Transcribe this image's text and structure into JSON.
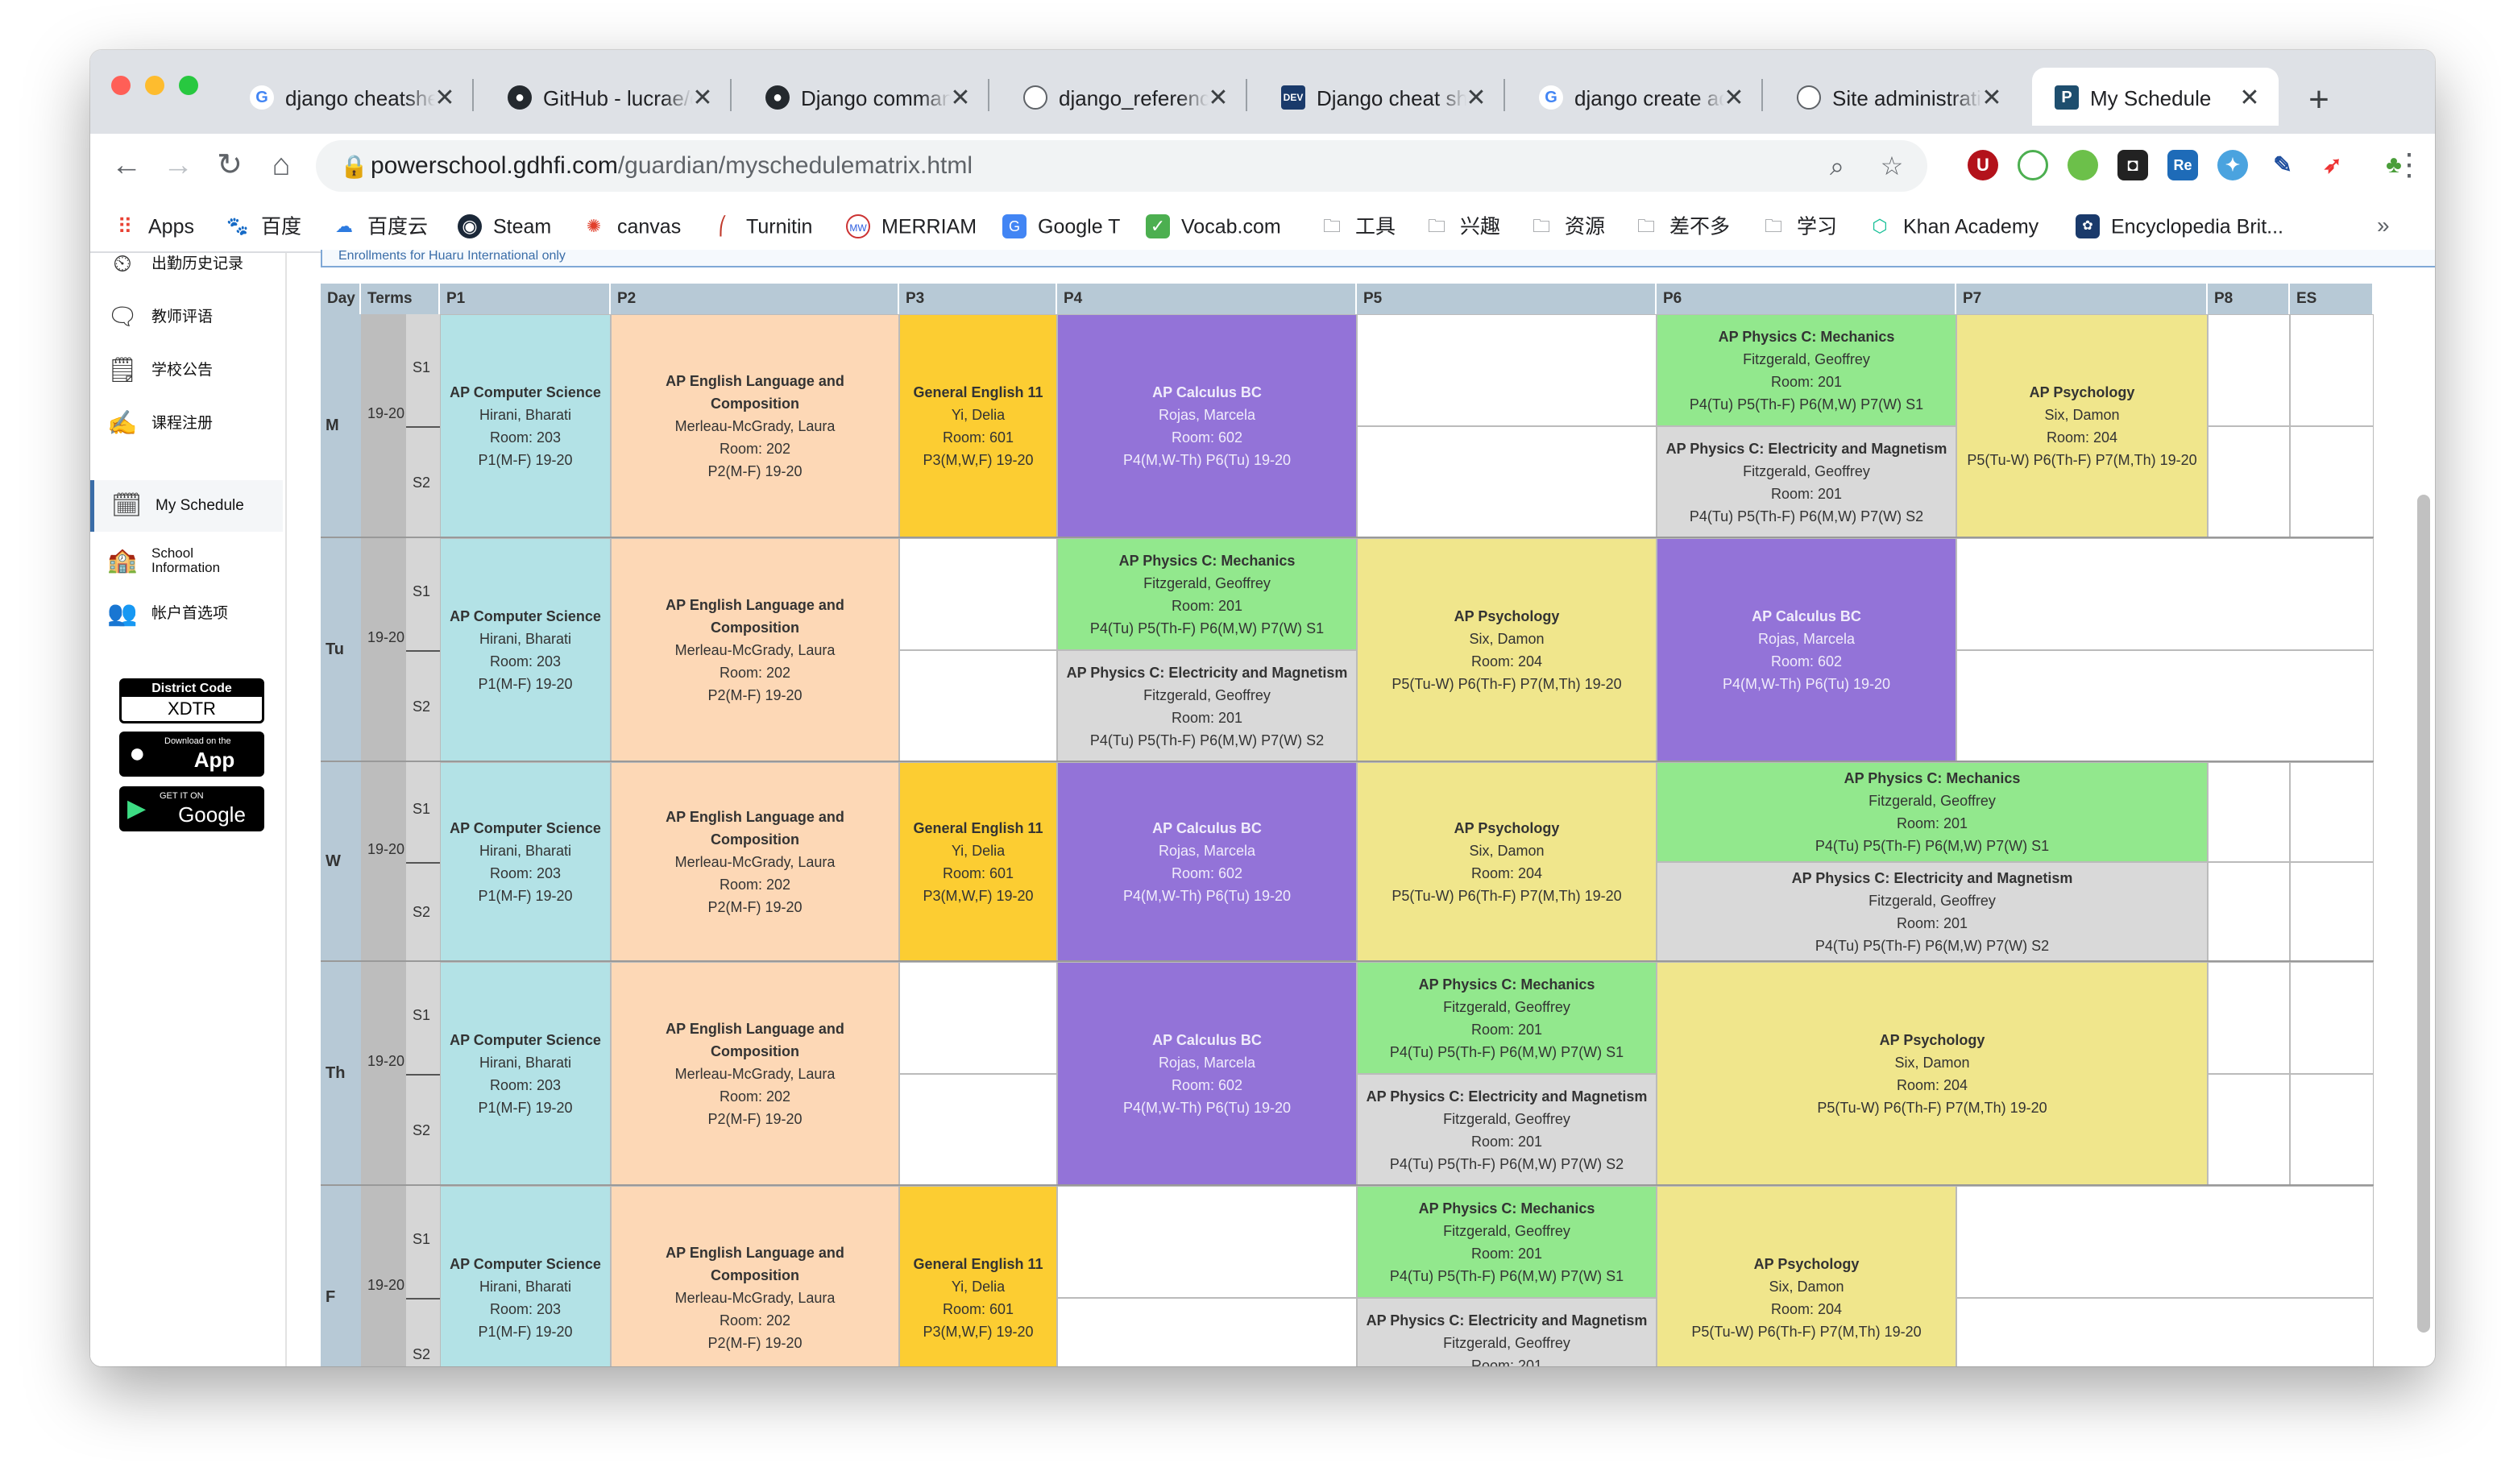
{
  "browser": {
    "tabs": [
      {
        "icon": "google-icon",
        "title": "django cheatshee",
        "active": false
      },
      {
        "icon": "github-icon",
        "title": "GitHub - lucrae/d",
        "active": false
      },
      {
        "icon": "github-icon",
        "title": "Django comman",
        "active": false
      },
      {
        "icon": "globe-icon",
        "title": "django_reference",
        "active": false
      },
      {
        "icon": "devs-icon",
        "title": "Django cheat she",
        "active": false
      },
      {
        "icon": "google-icon",
        "title": "django create ad",
        "active": false
      },
      {
        "icon": "globe-icon",
        "title": "Site administratio",
        "active": false
      },
      {
        "icon": "powerschool-icon",
        "title": "My Schedule",
        "active": true
      }
    ],
    "url": {
      "host": "powerschool.gdhfi.com",
      "path": "/guardian/myschedulematrix.html"
    },
    "bookmarks": [
      "Apps",
      "百度",
      "百度云",
      "Steam",
      "canvas",
      "Turnitin",
      "MERRIAM",
      "Google T",
      "Vocab.com",
      "工具",
      "兴趣",
      "资源",
      "差不多",
      "学习",
      "Khan Academy",
      "Encyclopedia Brit..."
    ],
    "bookmarks_overflow": "»",
    "new_tab": "+",
    "close_glyph": "✕"
  },
  "sidebar": {
    "items": [
      {
        "label": "出勤历史记录",
        "icon": "attendance-clock-icon"
      },
      {
        "label": "教师评语",
        "icon": "comment-icon"
      },
      {
        "label": "学校公告",
        "icon": "bulletin-icon"
      },
      {
        "label": "课程注册",
        "icon": "registration-icon"
      },
      {
        "label": "My Schedule",
        "icon": "schedule-clock-icon"
      },
      {
        "label": "School Information",
        "icon": "school-building-icon"
      },
      {
        "label": "帐户首选项",
        "icon": "account-prefs-icon"
      }
    ],
    "district_code": {
      "label": "District Code",
      "value": "XDTR"
    },
    "app_store": {
      "small": "Download on the",
      "big": "App Store"
    },
    "google_play": {
      "small": "GET IT ON",
      "big": "Google play"
    }
  },
  "schedule": {
    "notice": "Enrollments for Huaru International only",
    "headers": [
      "Day",
      "Terms",
      "P1",
      "P2",
      "P3",
      "P4",
      "P5",
      "P6",
      "P7",
      "P8",
      "ES"
    ],
    "days": [
      "M",
      "Tu",
      "W",
      "Th",
      "F"
    ],
    "term": "19-20",
    "sem1": "S1",
    "sem2": "S2",
    "courses": {
      "cs": {
        "name": "AP Computer Science",
        "teacher": "Hirani, Bharati",
        "room": "Room: 203",
        "meets": "P1(M-F) 19-20"
      },
      "eng": {
        "name": "AP English Language and Composition",
        "teacher": "Merleau-McGrady, Laura",
        "room": "Room: 202",
        "meets": "P2(M-F) 19-20"
      },
      "gen": {
        "name": "General English 11",
        "teacher": "Yi, Delia",
        "room": "Room: 601",
        "meets": "P3(M,W,F) 19-20"
      },
      "calc": {
        "name": "AP Calculus BC",
        "teacher": "Rojas, Marcela",
        "room": "Room: 602",
        "meets": "P4(M,W-Th) P6(Tu) 19-20"
      },
      "mech": {
        "name": "AP Physics C: Mechanics",
        "teacher": "Fitzgerald, Geoffrey",
        "room": "Room: 201",
        "meets": "P4(Tu) P5(Th-F) P6(M,W) P7(W) S1"
      },
      "em": {
        "name": "AP Physics C: Electricity and Magnetism",
        "teacher": "Fitzgerald, Geoffrey",
        "room": "Room: 201",
        "meets": "P4(Tu) P5(Th-F) P6(M,W) P7(W) S2"
      },
      "psych": {
        "name": "AP Psychology",
        "teacher": "Six, Damon",
        "room": "Room: 204",
        "meets": "P5(Tu-W) P6(Th-F) P7(M,Th) 19-20"
      }
    }
  },
  "colors": {
    "cs": "#b3e2e6",
    "eng": "#fdd8b6",
    "gen": "#fccd32",
    "calc": "#9373d8",
    "mech": "#92e88d",
    "em": "#d9d9d9",
    "psych": "#f0e68c",
    "header": "#b7c9d6"
  }
}
